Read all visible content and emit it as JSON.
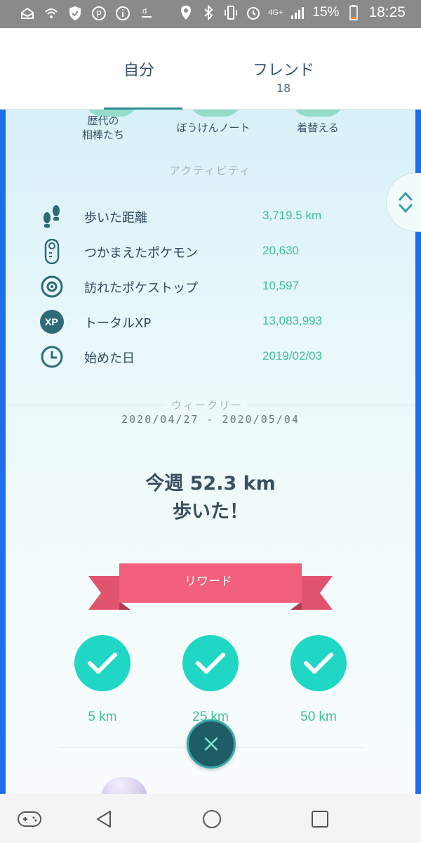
{
  "status_bar": {
    "battery": "15%",
    "time": "18:25",
    "network": "4G+",
    "icons": [
      "mail-icon",
      "wifi-call-icon",
      "shield-icon",
      "parking-icon",
      "info-icon",
      "d-app-icon",
      "location-icon",
      "bluetooth-icon",
      "vibrate-icon",
      "alarm-icon",
      "signal-icon",
      "battery-icon"
    ]
  },
  "tabs": [
    {
      "label": "自分",
      "active": true
    },
    {
      "label": "フレンド",
      "count": "18",
      "active": false
    }
  ],
  "top_items": [
    {
      "label": "歴代の\n相棒たち"
    },
    {
      "label": "ぼうけんノート"
    },
    {
      "label": "着替える"
    }
  ],
  "activity": {
    "title": "アクティビティ",
    "rows": [
      {
        "icon": "footprints-icon",
        "label": "歩いた距離",
        "value": "3,719.5 km"
      },
      {
        "icon": "pokedex-icon",
        "label": "つかまえたポケモン",
        "value": "20,630"
      },
      {
        "icon": "pokestop-icon",
        "label": "訪れたポケストップ",
        "value": "10,597"
      },
      {
        "icon": "xp-icon",
        "label": "トータルXP",
        "value": "13,083,993"
      },
      {
        "icon": "clock-icon",
        "label": "始めた日",
        "value": "2019/02/03"
      }
    ]
  },
  "weekly": {
    "title": "ウィークリー",
    "range": "2020/04/27 - 2020/05/04",
    "line1": "今週 52.3 km",
    "line2": "歩いた！",
    "reward_label": "リワード",
    "milestones": [
      "5 km",
      "25 km",
      "50 km"
    ]
  },
  "colors": {
    "accent": "#1fd7c4",
    "value_green": "#3fbf95",
    "ribbon": "#f0607a",
    "border_blue": "#1e6ee8",
    "text_dark": "#2f4a5f"
  }
}
